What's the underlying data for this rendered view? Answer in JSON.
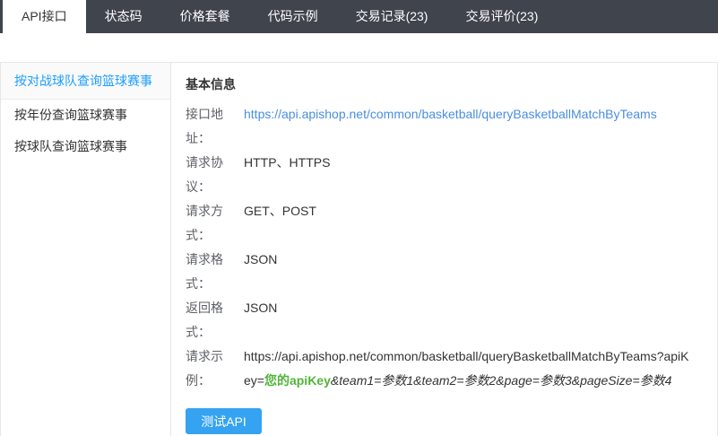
{
  "tabs": [
    {
      "label": "API接口",
      "active": true
    },
    {
      "label": "状态码",
      "active": false
    },
    {
      "label": "价格套餐",
      "active": false
    },
    {
      "label": "代码示例",
      "active": false
    },
    {
      "label": "交易记录(23)",
      "active": false
    },
    {
      "label": "交易评价(23)",
      "active": false
    }
  ],
  "sidebar": {
    "items": [
      {
        "label": "按对战球队查询篮球赛事",
        "active": true
      },
      {
        "label": "按年份查询篮球赛事",
        "active": false
      },
      {
        "label": "按球队查询篮球赛事",
        "active": false
      }
    ]
  },
  "main": {
    "section_title": "基本信息",
    "fields": [
      {
        "label": "接口地址：",
        "value": "https://api.apishop.net/common/basketball/queryBasketballMatchByTeams",
        "type": "link"
      },
      {
        "label": "请求协议：",
        "value": "HTTP、HTTPS",
        "type": "text"
      },
      {
        "label": "请求方式：",
        "value": "GET、POST",
        "type": "text"
      },
      {
        "label": "请求格式：",
        "value": "JSON",
        "type": "text"
      },
      {
        "label": "返回格式：",
        "value": "JSON",
        "type": "text"
      }
    ],
    "example": {
      "label": "请求示例：",
      "url_prefix": "https://api.apishop.net/common/basketball/queryBasketballMatchByTeams?apiKey=",
      "apikey_highlight": "您的apiKey",
      "params_suffix": "&team1=参数1&team2=参数2&page=参数3&pageSize=参数4"
    },
    "test_button_label": "测试API"
  },
  "colors": {
    "tab_bar_bg": "#3f444d",
    "accent_blue": "#1e9fff",
    "link_blue": "#4a8ee0",
    "apikey_green": "#52b43a",
    "button_blue": "#35a3f1"
  }
}
